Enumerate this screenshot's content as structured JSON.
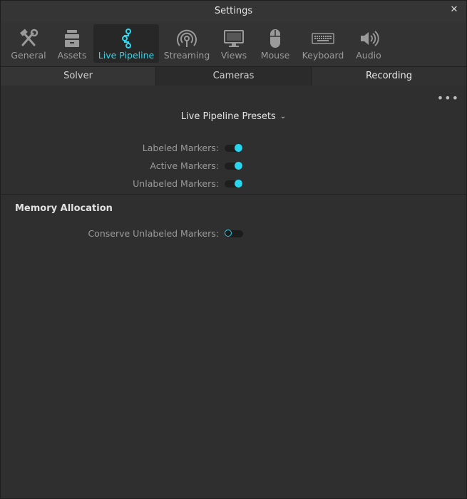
{
  "window": {
    "title": "Settings"
  },
  "toolbar": {
    "items": [
      {
        "label": "General",
        "icon": "tools-icon"
      },
      {
        "label": "Assets",
        "icon": "assets-icon"
      },
      {
        "label": "Live Pipeline",
        "icon": "pipeline-icon",
        "active": true
      },
      {
        "label": "Streaming",
        "icon": "broadcast-icon"
      },
      {
        "label": "Views",
        "icon": "monitor-icon"
      },
      {
        "label": "Mouse",
        "icon": "mouse-icon"
      },
      {
        "label": "Keyboard",
        "icon": "keyboard-icon"
      },
      {
        "label": "Audio",
        "icon": "speaker-icon"
      }
    ],
    "accent_color": "#2fd8ef"
  },
  "tabs": [
    "Solver",
    "Cameras",
    "Recording"
  ],
  "presets": {
    "label": "Live Pipeline Presets"
  },
  "settings": [
    {
      "label": "Labeled Markers:",
      "enabled": true
    },
    {
      "label": "Active Markers:",
      "enabled": true
    },
    {
      "label": "Unlabeled Markers:",
      "enabled": true
    }
  ],
  "memory": {
    "title": "Memory Allocation",
    "settings": [
      {
        "label": "Conserve Unlabeled Markers:",
        "enabled": false
      }
    ]
  }
}
